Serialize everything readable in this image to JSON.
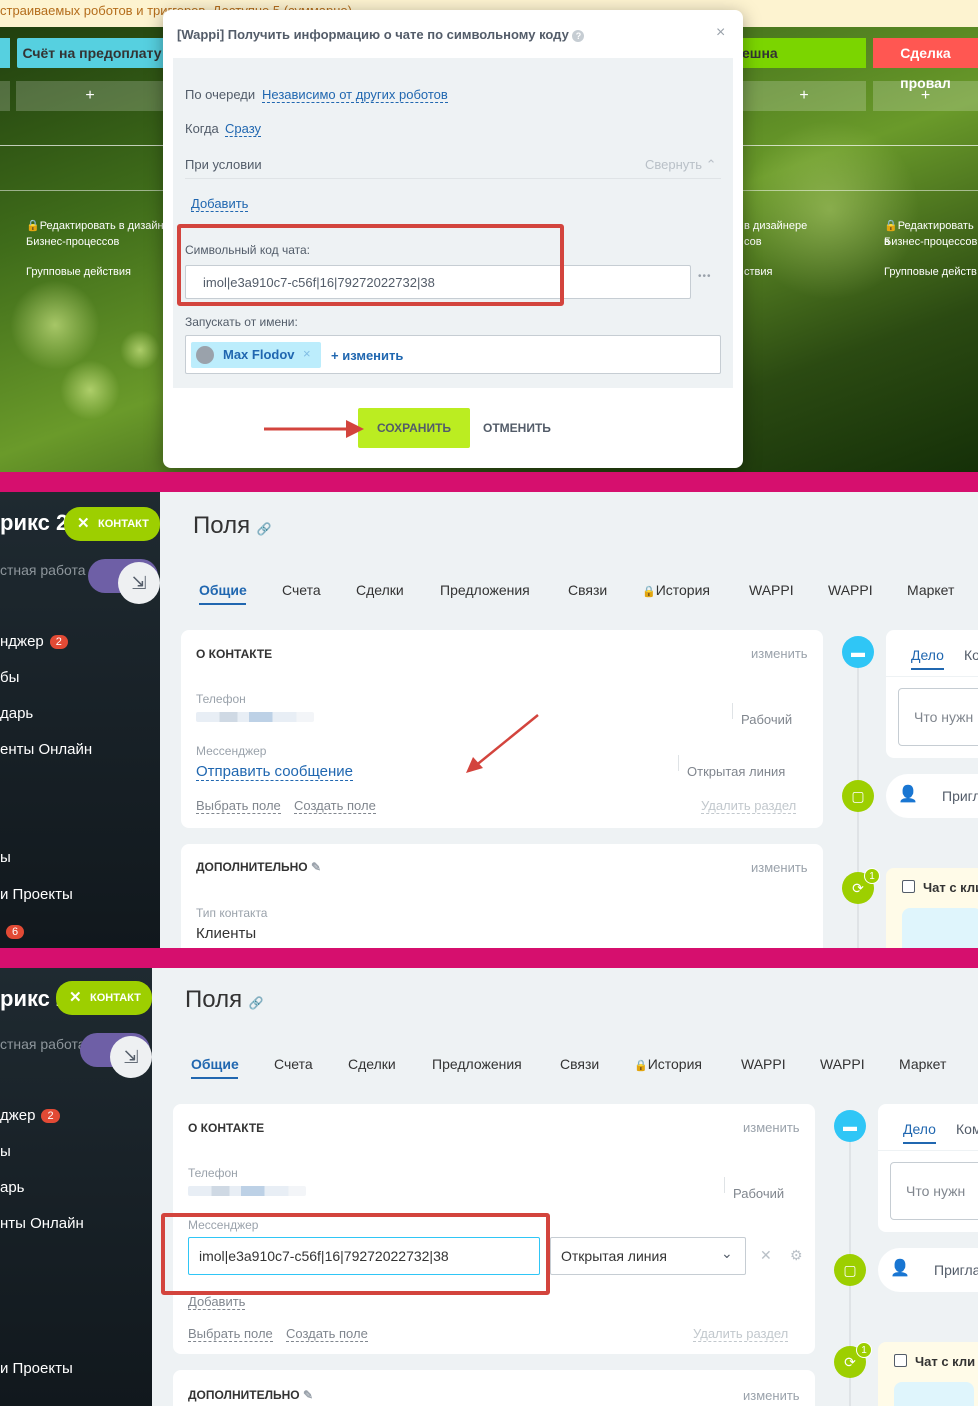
{
  "top_panel": {
    "notice": "страиваемых роботов и триггеров. Доступно 5 (суммарно)",
    "stages": {
      "left": "Счёт на предоплату",
      "right_partial": "ешна",
      "lost": "Сделка провал"
    },
    "plus": "+",
    "designer_lock_text": "Редактировать в дизайне",
    "designer_lock_text_2": "Бизнес-процессов",
    "group_actions": "Групповые действия",
    "right_lock_1": "в дизайнере",
    "right_lock_2": "сов",
    "right_lock_3": "ствия",
    "right_lock_a": "Редактировать в",
    "right_lock_b": "Бизнес-процессов",
    "right_lock_c": "Групповые действ"
  },
  "dialog": {
    "title": "[Wappi] Получить информацию о чате по символьному коду",
    "close": "×",
    "queue_label": "По очереди",
    "queue_value": "Независимо от других роботов",
    "when_label": "Когда",
    "when_value": "Сразу",
    "condition_label": "При условии",
    "collapse": "Свернуть",
    "add": "Добавить",
    "code_label": "Символьный код чата:",
    "code_value": "imol|e3a910c7-c56f|16|79272022732|38",
    "more": "•••",
    "run_as_label": "Запускать от имени:",
    "user_name": "Max Flodov",
    "change": "+ изменить",
    "save": "СОХРАНИТЬ",
    "cancel": "ОТМЕНИТЬ"
  },
  "crm1": {
    "brand": "рикс 2",
    "contact_btn": "КОНТАКТ",
    "menu": [
      {
        "label": "стная работа"
      },
      {
        "label": "нджер",
        "badge": "2"
      },
      {
        "label": "бы"
      },
      {
        "label": "дарь"
      },
      {
        "label": "енты Онлайн"
      },
      {
        "label": "ы"
      },
      {
        "label": "и Проекты"
      },
      {
        "label": "",
        "badge": "6"
      }
    ],
    "page_title": "Поля",
    "tabs": [
      "Общие",
      "Счета",
      "Сделки",
      "Предложения",
      "Связи",
      "История",
      "WAPPI",
      "WAPPI",
      "Маркет"
    ],
    "about": "О КОНТАКТЕ",
    "edit": "изменить",
    "phone_label": "Телефон",
    "phone_type": "Рабочий",
    "messenger_label": "Мессенджер",
    "send_message": "Отправить сообщение",
    "open_line": "Открытая линия",
    "choose_field": "Выбрать поле",
    "create_field": "Создать поле",
    "delete_section": "Удалить раздел",
    "additional": "ДОПОЛНИТЕЛЬНО",
    "contact_type_label": "Тип контакта",
    "contact_type_value": "Клиенты",
    "timeline": {
      "tab_deal": "Дело",
      "tab_ko": "Ко",
      "placeholder": "Что нужн",
      "invite": "Пригл",
      "chat": "Чат с кли",
      "chat_badge": "1"
    }
  },
  "crm2": {
    "brand": "рикс 2",
    "contact_btn": "КОНТАКТ",
    "menu": [
      {
        "label": "стная работа"
      },
      {
        "label": "джер",
        "badge": "2"
      },
      {
        "label": "ы"
      },
      {
        "label": "арь"
      },
      {
        "label": "нты Онлайн"
      },
      {
        "label": "и Проекты"
      }
    ],
    "page_title": "Поля",
    "tabs": [
      "Общие",
      "Счета",
      "Сделки",
      "Предложения",
      "Связи",
      "История",
      "WAPPI",
      "WAPPI",
      "Маркет"
    ],
    "about": "О КОНТАКТЕ",
    "edit": "изменить",
    "phone_label": "Телефон",
    "phone_type": "Рабочий",
    "messenger_label": "Мессенджер",
    "messenger_value": "imol|e3a910c7-c56f|16|79272022732|38",
    "open_line_select": "Открытая линия",
    "add": "Добавить",
    "choose_field": "Выбрать поле",
    "create_field": "Создать поле",
    "delete_section": "Удалить раздел",
    "additional": "ДОПОЛНИТЕЛЬНО",
    "timeline": {
      "tab_deal": "Дело",
      "tab_ko": "Ком",
      "placeholder": "Что нужн",
      "invite": "Пригла",
      "chat": "Чат с кли",
      "chat_badge": "1"
    }
  },
  "colors": {
    "accent_green": "#bbed21",
    "link_blue": "#2067b0",
    "highlight_red": "#d3443d",
    "separator": "#d60f6e"
  }
}
